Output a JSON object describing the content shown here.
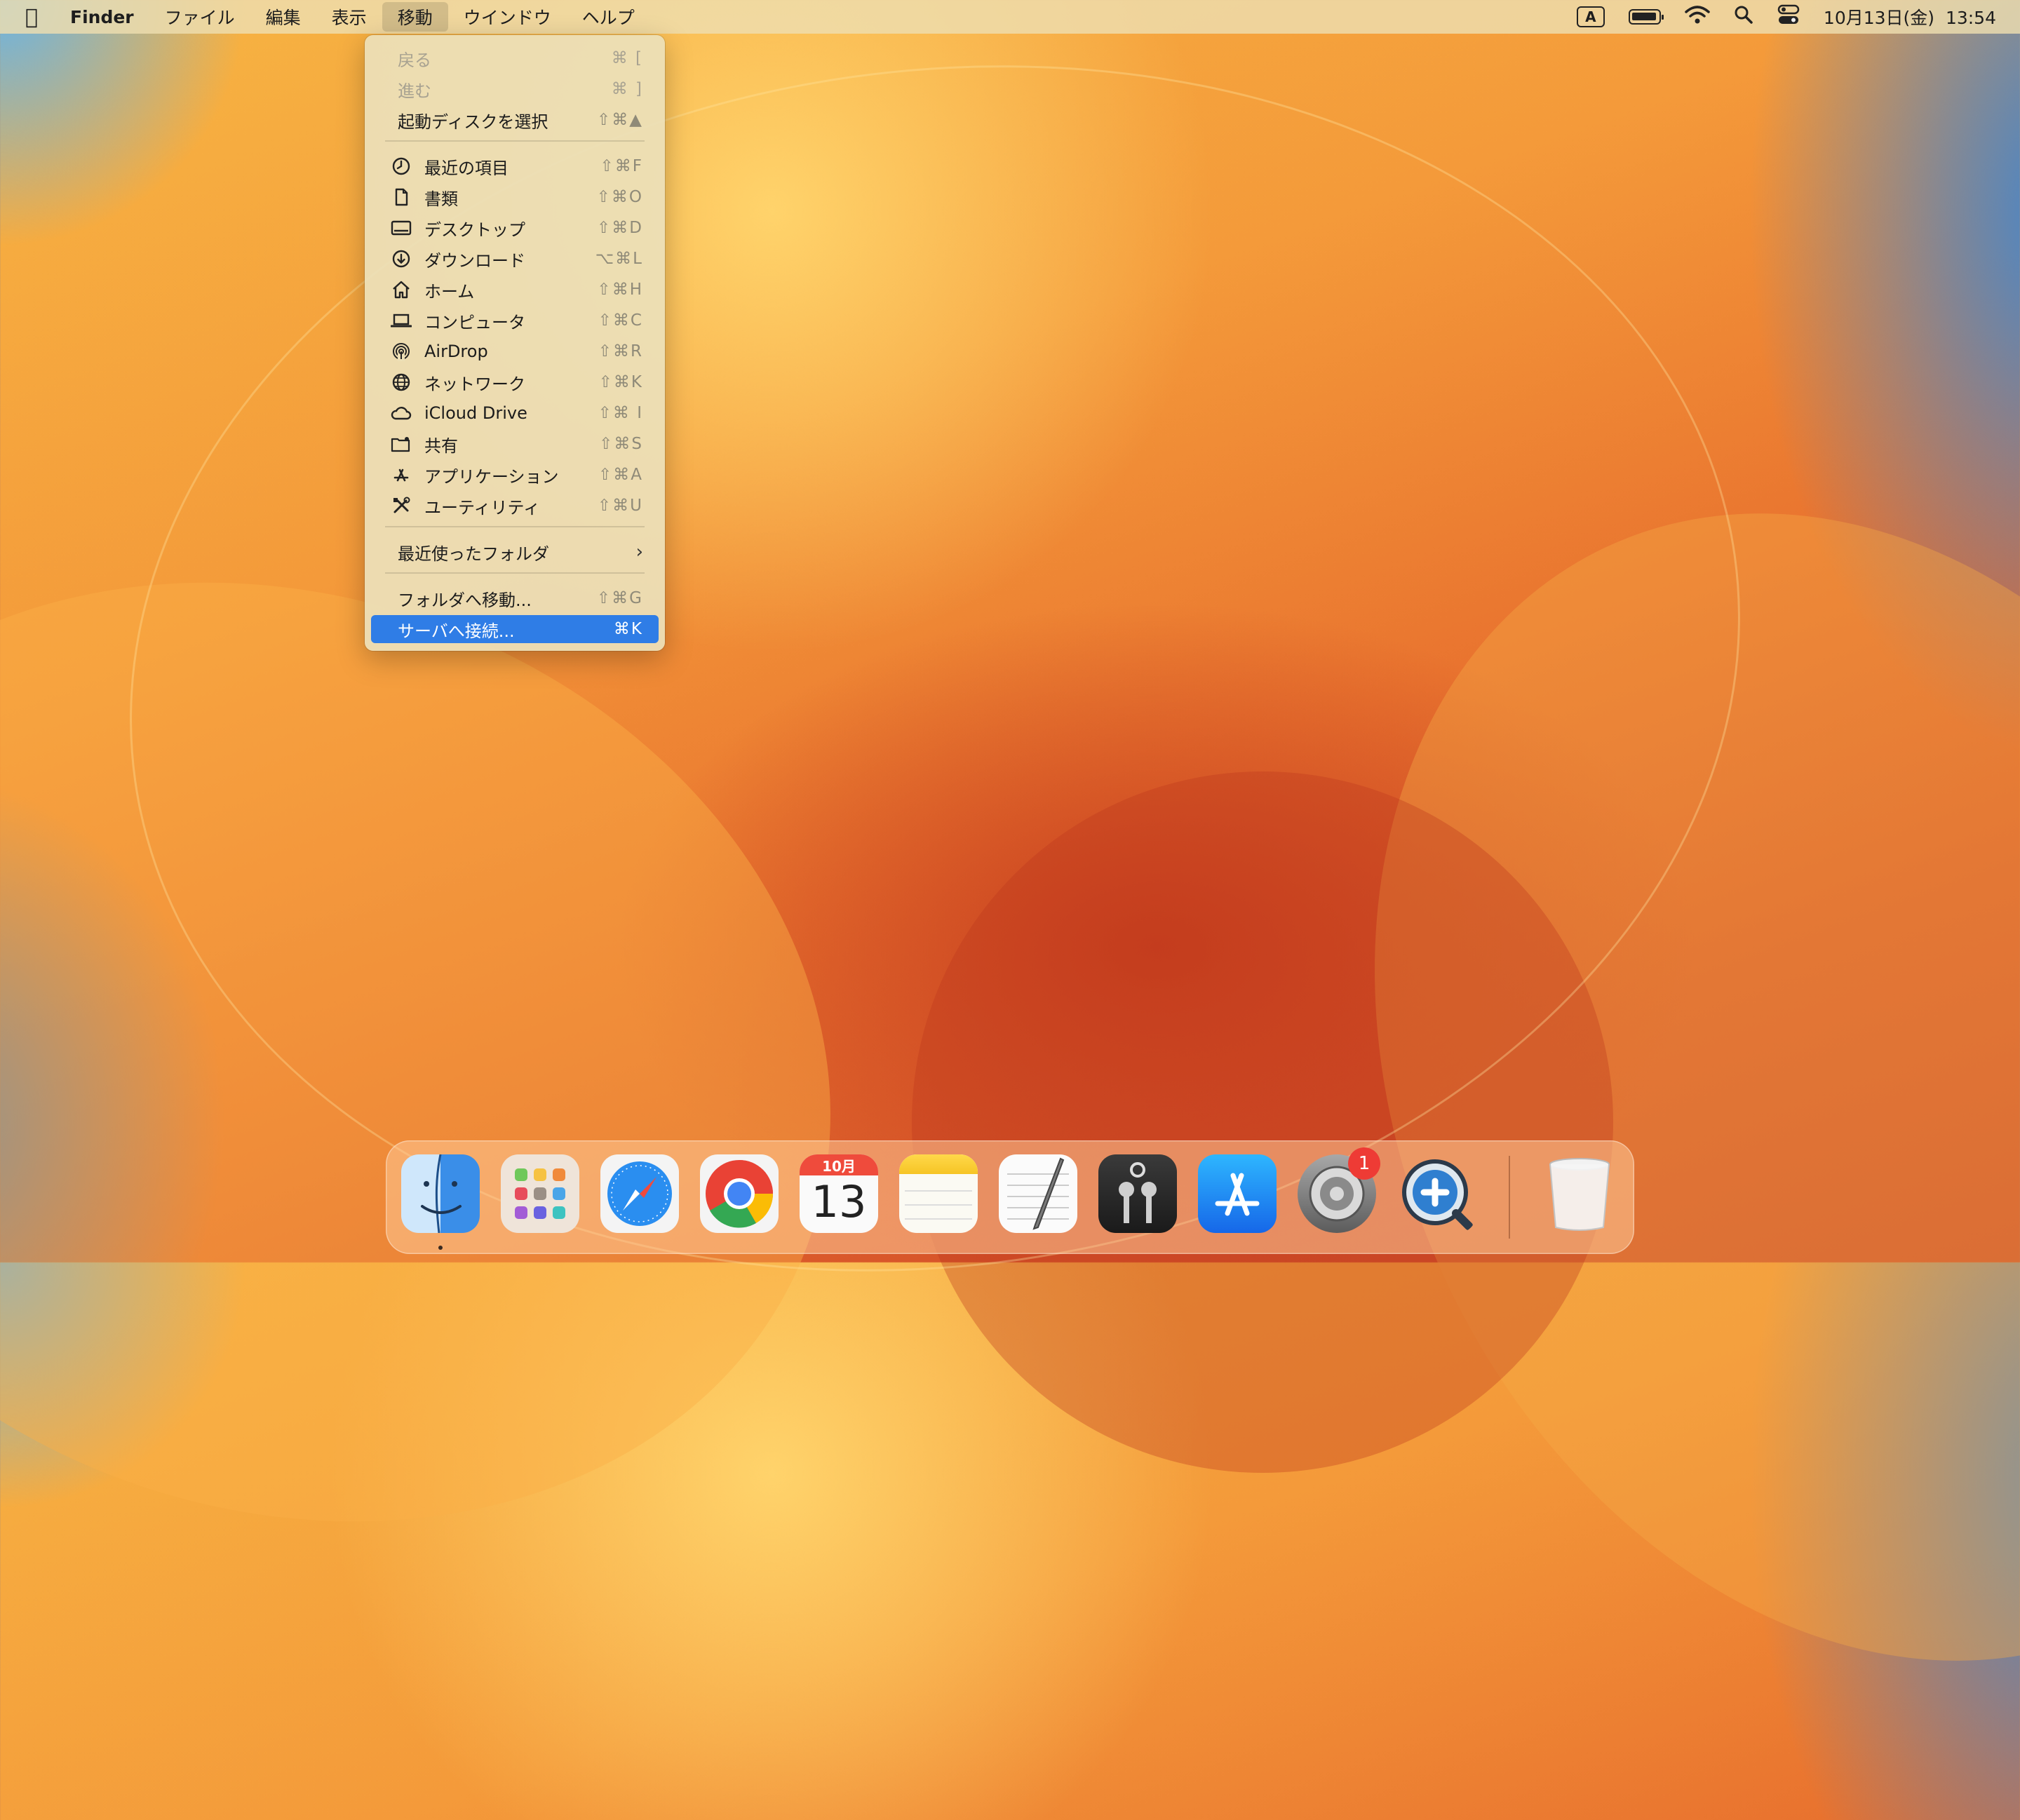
{
  "menubar": {
    "app_name": "Finder",
    "menus": [
      "ファイル",
      "編集",
      "表示",
      "移動",
      "ウインドウ",
      "ヘルプ"
    ],
    "input_method": "A",
    "datetime": "10月13日(金)  13:54"
  },
  "go_menu": {
    "items": [
      {
        "label": "戻る",
        "shortcut": "⌘ [",
        "disabled": true
      },
      {
        "label": "進む",
        "shortcut": "⌘ ]",
        "disabled": true
      },
      {
        "label": "起動ディスクを選択",
        "shortcut": "⇧⌘▲"
      },
      {
        "label": "最近の項目",
        "shortcut": "⇧⌘F",
        "icon": "clock-icon"
      },
      {
        "label": "書類",
        "shortcut": "⇧⌘O",
        "icon": "document-icon"
      },
      {
        "label": "デスクトップ",
        "shortcut": "⇧⌘D",
        "icon": "desktop-icon"
      },
      {
        "label": "ダウンロード",
        "shortcut": "⌥⌘L",
        "icon": "download-icon"
      },
      {
        "label": "ホーム",
        "shortcut": "⇧⌘H",
        "icon": "home-icon"
      },
      {
        "label": "コンピュータ",
        "shortcut": "⇧⌘C",
        "icon": "laptop-icon"
      },
      {
        "label": "AirDrop",
        "shortcut": "⇧⌘R",
        "icon": "airdrop-icon"
      },
      {
        "label": "ネットワーク",
        "shortcut": "⇧⌘K",
        "icon": "globe-icon"
      },
      {
        "label": "iCloud Drive",
        "shortcut": "⇧⌘ I",
        "icon": "cloud-icon"
      },
      {
        "label": "共有",
        "shortcut": "⇧⌘S",
        "icon": "shared-folder-icon"
      },
      {
        "label": "アプリケーション",
        "shortcut": "⇧⌘A",
        "icon": "applications-icon"
      },
      {
        "label": "ユーティリティ",
        "shortcut": "⇧⌘U",
        "icon": "tools-icon"
      },
      {
        "label": "最近使ったフォルダ",
        "submenu": true
      },
      {
        "label": "フォルダへ移動...",
        "shortcut": "⇧⌘G"
      },
      {
        "label": "サーバへ接続...",
        "shortcut": "⌘K",
        "highlighted": true
      }
    ]
  },
  "dock": {
    "calendar_month": "10月",
    "calendar_day": "13",
    "settings_badge": "1",
    "apps": [
      "finder-icon",
      "launchpad-icon",
      "safari-icon",
      "chrome-icon",
      "calendar-icon",
      "notes-icon",
      "textedit-icon",
      "keychain-icon",
      "app-store-icon",
      "system-settings-icon",
      "zoom-utility-icon",
      "trash-icon"
    ]
  },
  "colors": {
    "highlight": "#2f7de6",
    "badge": "#ee3b35"
  }
}
